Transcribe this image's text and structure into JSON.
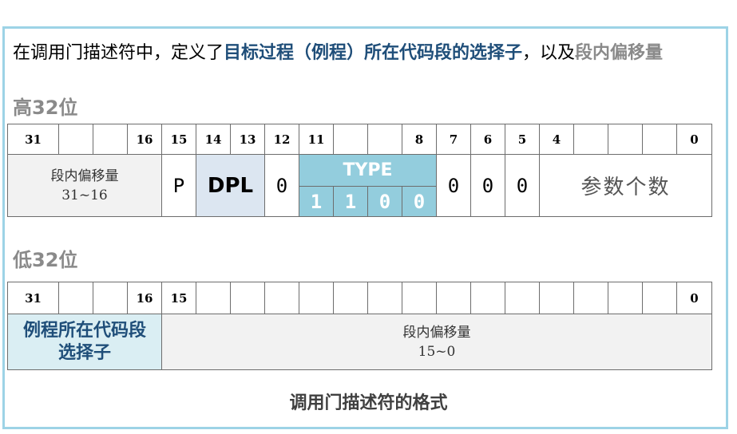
{
  "intro": {
    "part1": "在调用门描述符中，定义了",
    "part2": "目标过程（例程）所在代码段的选择子",
    "part3": "，以及",
    "part4": "段内偏移量"
  },
  "high": {
    "title": "高32位",
    "bit_labels": [
      "31",
      "",
      "",
      "16",
      "15",
      "14",
      "13",
      "12",
      "11",
      "",
      "",
      "8",
      "7",
      "6",
      "5",
      "4",
      "",
      "",
      "",
      "0"
    ],
    "offset_label_line1": "段内偏移量",
    "offset_label_line2": "31~16",
    "p": "P",
    "dpl": "DPL",
    "bit12": "0",
    "type_label": "TYPE",
    "type_bits": [
      "1",
      "1",
      "0",
      "0"
    ],
    "bits7_5": [
      "0",
      "0",
      "0"
    ],
    "param_count": "参数个数"
  },
  "low": {
    "title": "低32位",
    "bit_labels": [
      "31",
      "",
      "",
      "16",
      "15",
      "",
      "",
      "",
      "",
      "",
      "",
      "",
      "",
      "",
      "",
      "",
      "",
      "",
      "",
      "0"
    ],
    "selector_line1": "例程所在代码段",
    "selector_line2": "选择子",
    "offset_label_line1": "段内偏移量",
    "offset_label_line2": "15~0"
  },
  "caption": "调用门描述符的格式",
  "colors": {
    "frame": "#9dd3e6",
    "offset_field": "#f2f2f2",
    "dpl_field": "#dce6f1",
    "type_field": "#93cddd",
    "selector_field": "#daeef3",
    "highlight_text": "#1f4e79",
    "grey_text": "#8a8a8a"
  }
}
